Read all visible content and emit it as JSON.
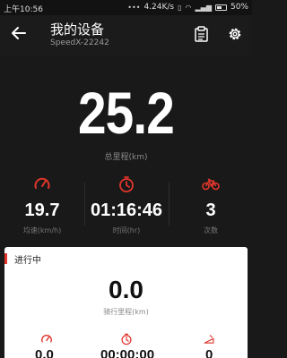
{
  "status_bar": {
    "time": "上午10:56",
    "network_speed": "4.24K/s",
    "battery": "50%",
    "battery_level": 0.5
  },
  "app_bar": {
    "title": "我的设备",
    "subtitle": "SpeedX-22242"
  },
  "summary": {
    "distance_value": "25.2",
    "distance_label": "总里程(km)"
  },
  "stats": [
    {
      "icon": "speedometer-icon",
      "value": "19.7",
      "label": "均速(km/h)"
    },
    {
      "icon": "stopwatch-icon",
      "value": "01:16:46",
      "label": "时间(hr)"
    },
    {
      "icon": "bicycle-icon",
      "value": "3",
      "label": "次数"
    }
  ],
  "current_ride": {
    "status": "进行中",
    "distance_value": "0.0",
    "distance_label": "骑行里程(km)",
    "stats": [
      {
        "icon": "speedometer-icon",
        "value": "0.0"
      },
      {
        "icon": "stopwatch-icon",
        "value": "00:00:00"
      },
      {
        "icon": "slope-icon",
        "value": "0"
      }
    ]
  },
  "colors": {
    "background": "#191919",
    "accent": "#e0362b",
    "card": "#ffffff"
  }
}
